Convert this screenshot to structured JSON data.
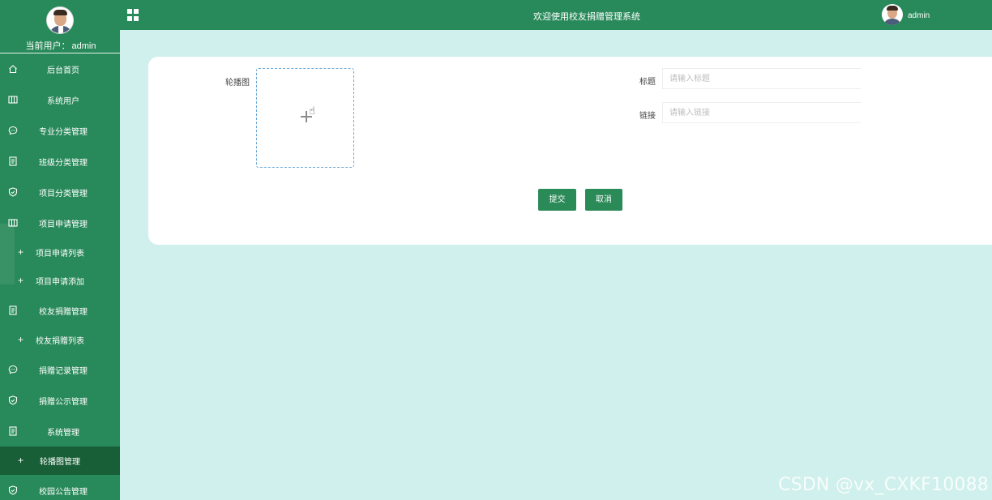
{
  "sidebar": {
    "current_user_label": "当前用户：",
    "current_user": "admin",
    "items": [
      {
        "icon": "home-icon",
        "label": "后台首页"
      },
      {
        "icon": "table-icon",
        "label": "系统用户"
      },
      {
        "icon": "chat-icon",
        "label": "专业分类管理"
      },
      {
        "icon": "document-icon",
        "label": "班级分类管理"
      },
      {
        "icon": "shield-icon",
        "label": "项目分类管理"
      },
      {
        "icon": "table-icon",
        "label": "项目申请管理"
      },
      {
        "sub": true,
        "label": "项目申请列表"
      },
      {
        "sub": true,
        "label": "项目申请添加"
      },
      {
        "icon": "document-icon",
        "label": "校友捐赠管理"
      },
      {
        "sub": true,
        "label": "校友捐赠列表"
      },
      {
        "icon": "chat-icon",
        "label": "捐赠记录管理"
      },
      {
        "icon": "shield-icon",
        "label": "捐赠公示管理"
      },
      {
        "icon": "document-icon",
        "label": "系统管理"
      },
      {
        "sub": true,
        "active": true,
        "label": "轮播图管理"
      },
      {
        "icon": "shield-icon",
        "label": "校园公告管理"
      }
    ]
  },
  "header": {
    "menu_icon": "grid-icon",
    "title": "欢迎使用校友捐赠管理系统",
    "user": "admin"
  },
  "form": {
    "image_label": "轮播图",
    "title_label": "标题",
    "title_placeholder": "请输入标题",
    "link_label": "链接",
    "link_placeholder": "请输入链接",
    "submit_label": "提交",
    "cancel_label": "取消"
  },
  "watermark": "CSDN @vx_CXKF10088",
  "colors": {
    "primary": "#28895a",
    "active_menu": "#185f37",
    "background": "#cff0ec"
  }
}
